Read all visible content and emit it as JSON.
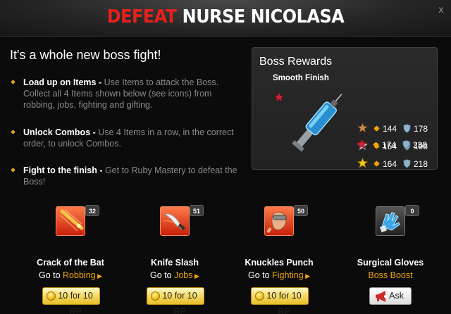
{
  "header": {
    "title_defeat": "DEFEAT",
    "title_name": "NURSE NICOLASA",
    "close": "x"
  },
  "intro": "It's a whole new boss fight!",
  "bullets": [
    {
      "bold": "Load up on Items -",
      "text": " Use Items to attack the Boss. Collect all 4 Items shown below (see icons) from robbing, jobs, fighting and gifting."
    },
    {
      "bold": "Unlock Combos -",
      "text": " Use 4 Items in a row, in the correct order, to unlock Combos."
    },
    {
      "bold": "Fight to the finish -",
      "text": " Get to Ruby Mastery to defeat the Boss!"
    }
  ],
  "rewards": {
    "title": "Boss Rewards",
    "item_name": "Smooth Finish",
    "tiers": [
      {
        "star": "bronze",
        "attack": "144",
        "defense": "178"
      },
      {
        "star": "silver",
        "attack": "154",
        "defense": "198"
      },
      {
        "star": "gold",
        "attack": "164",
        "defense": "218"
      },
      {
        "star": "ruby",
        "attack": "174",
        "defense": "238"
      }
    ]
  },
  "items": [
    {
      "name": "Crack of the Bat",
      "count": "32",
      "goto": "Go to",
      "link": "Robbing",
      "button": "10 for 10 RP",
      "icon": "bat-icon"
    },
    {
      "name": "Knife Slash",
      "count": "51",
      "goto": "Go to",
      "link": "Jobs",
      "button": "10 for 10 RP",
      "icon": "knife-icon"
    },
    {
      "name": "Knuckles Punch",
      "count": "50",
      "goto": "Go to",
      "link": "Fighting",
      "button": "10 for 10 RP",
      "icon": "knuckles-icon"
    },
    {
      "name": "Surgical Gloves",
      "count": "0",
      "boost": "Boss Boost",
      "button": "Ask",
      "icon": "gloves-icon"
    }
  ],
  "colors": {
    "accent_red": "#e8201c",
    "link_orange": "#f2a50c",
    "bullet_gold": "#e8a412",
    "button_gold": "#f5dd6c"
  }
}
